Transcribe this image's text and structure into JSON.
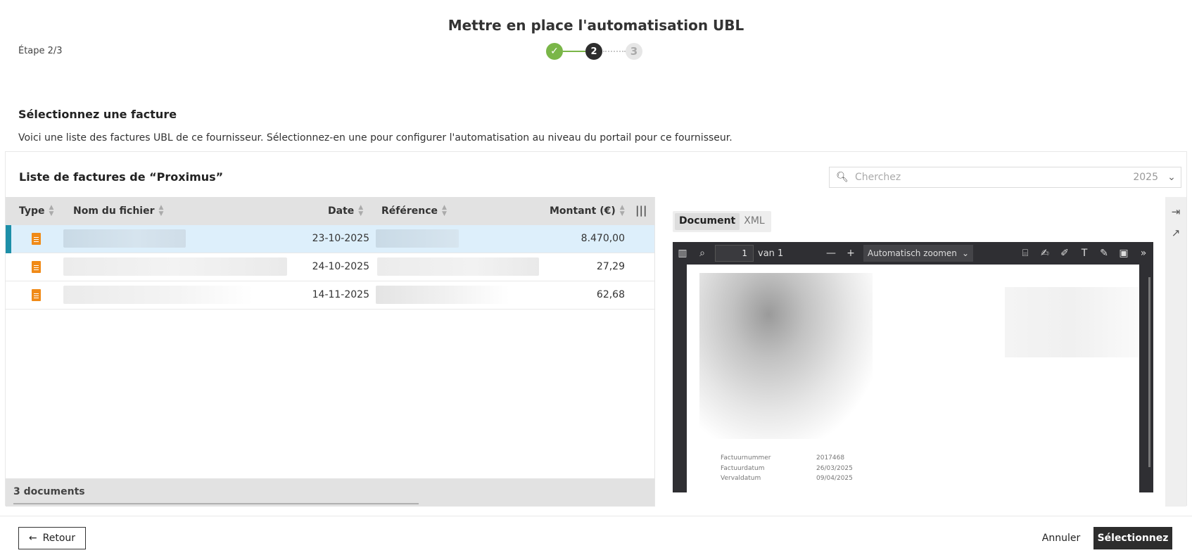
{
  "header": {
    "title": "Mettre en place l'automatisation UBL",
    "step_label": "Étape 2/3",
    "stepper": {
      "done_icon": "check-icon",
      "current": "2",
      "next": "3"
    }
  },
  "section": {
    "title": "Sélectionnez une facture",
    "description": "Voici une liste des factures UBL de ce fournisseur. Sélectionnez-en une pour configurer l'automatisation au niveau du portail pour ce fournisseur."
  },
  "list": {
    "title": "Liste de factures de “Proximus”",
    "search_placeholder": "Cherchez",
    "year": "2025",
    "columns": [
      "Type",
      "Nom du fichier",
      "Date",
      "Référence",
      "Montant (€)"
    ],
    "rows": [
      {
        "date": "23-10-2025",
        "amount": "8.470,00",
        "selected": true
      },
      {
        "date": "24-10-2025",
        "amount": "27,29",
        "selected": false
      },
      {
        "date": "14-11-2025",
        "amount": "62,68",
        "selected": false
      }
    ],
    "footer": "3 documents"
  },
  "preview": {
    "tabs": [
      "Document",
      "XML"
    ],
    "page_number": "1",
    "page_of": "van 1",
    "zoom": "Automatisch zoomen",
    "meta": [
      {
        "key": "Factuurnummer",
        "value": "2017468"
      },
      {
        "key": "Factuurdatum",
        "value": "26/03/2025"
      },
      {
        "key": "Vervaldatum",
        "value": "09/04/2025"
      }
    ]
  },
  "buttons": {
    "back": "Retour",
    "cancel": "Annuler",
    "select": "Sélectionnez"
  },
  "colors": {
    "accent": "#1d8fa8",
    "done": "#7ab648",
    "file_icon": "#f08a17",
    "primary": "#2d2d2d"
  }
}
